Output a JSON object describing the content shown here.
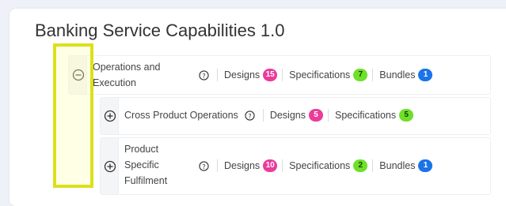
{
  "page": {
    "title": "Banking Service Capabilities 1.0"
  },
  "rows": [
    {
      "label_line1": "Operations and",
      "label_line2": "Execution",
      "expanded": true,
      "toggle_icon": "minus-circle-icon",
      "metrics": [
        {
          "label": "Designs",
          "count": "15",
          "color": "#ec3b9a"
        },
        {
          "label": "Specifications",
          "count": "7",
          "color": "#6ee02a"
        },
        {
          "label": "Bundles",
          "count": "1",
          "color": "#1a73e8"
        }
      ]
    },
    {
      "label": "Cross Product Operations",
      "expanded": false,
      "toggle_icon": "plus-circle-icon",
      "metrics": [
        {
          "label": "Designs",
          "count": "5",
          "color": "#ec3b9a"
        },
        {
          "label": "Specifications",
          "count": "5",
          "color": "#6ee02a"
        }
      ]
    },
    {
      "label_line1": "Product",
      "label_line2": "Specific",
      "label_line3": "Fulfilment",
      "expanded": false,
      "toggle_icon": "plus-circle-icon",
      "metrics": [
        {
          "label": "Designs",
          "count": "10",
          "color": "#ec3b9a"
        },
        {
          "label": "Specifications",
          "count": "2",
          "color": "#6ee02a"
        },
        {
          "label": "Bundles",
          "count": "1",
          "color": "#1a73e8"
        }
      ]
    }
  ],
  "colors": {
    "highlight": "#dde01b",
    "designs_badge": "#ec3b9a",
    "specifications_badge": "#6ee02a",
    "bundles_badge": "#1a73e8"
  }
}
